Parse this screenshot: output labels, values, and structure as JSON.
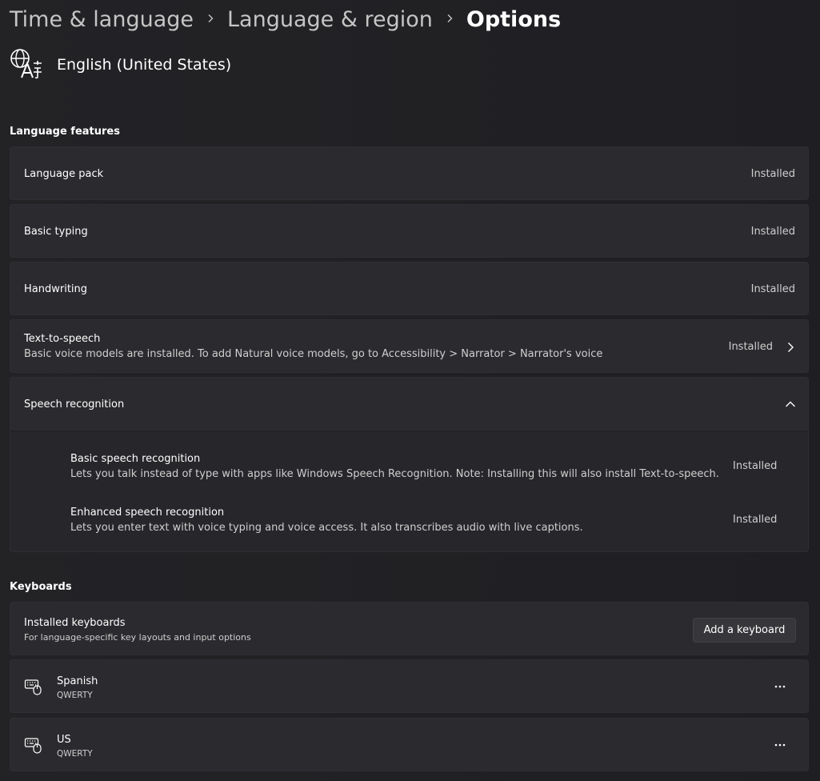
{
  "breadcrumb": {
    "items": [
      "Time & language",
      "Language & region",
      "Options"
    ]
  },
  "language": {
    "name": "English (United States)",
    "icon": "language-icon"
  },
  "language_features": {
    "title": "Language features",
    "items": [
      {
        "label": "Language pack",
        "status": "Installed"
      },
      {
        "label": "Basic typing",
        "status": "Installed"
      },
      {
        "label": "Handwriting",
        "status": "Installed"
      },
      {
        "label": "Text-to-speech",
        "description": "Basic voice models are installed. To add Natural voice models, go to Accessibility > Narrator > Narrator's voice",
        "status": "Installed"
      }
    ],
    "speech": {
      "label": "Speech recognition",
      "expanded": true,
      "items": [
        {
          "label": "Basic speech recognition",
          "description": "Lets you talk instead of type with apps like Windows Speech Recognition. Note: Installing this will also install Text-to-speech.",
          "status": "Installed"
        },
        {
          "label": "Enhanced speech recognition",
          "description": "Lets you enter text with voice typing and voice access. It also transcribes audio with live captions.",
          "status": "Installed"
        }
      ]
    }
  },
  "keyboards": {
    "title": "Keyboards",
    "installed_label": "Installed keyboards",
    "installed_desc": "For language-specific key layouts and input options",
    "add_button": "Add a keyboard",
    "items": [
      {
        "name": "Spanish",
        "layout": "QWERTY"
      },
      {
        "name": "US",
        "layout": "QWERTY"
      }
    ]
  },
  "colors": {
    "background": "#202024",
    "card": "#2b2b2f",
    "text": "#ffffff",
    "secondary_text": "#cfcfcf"
  }
}
